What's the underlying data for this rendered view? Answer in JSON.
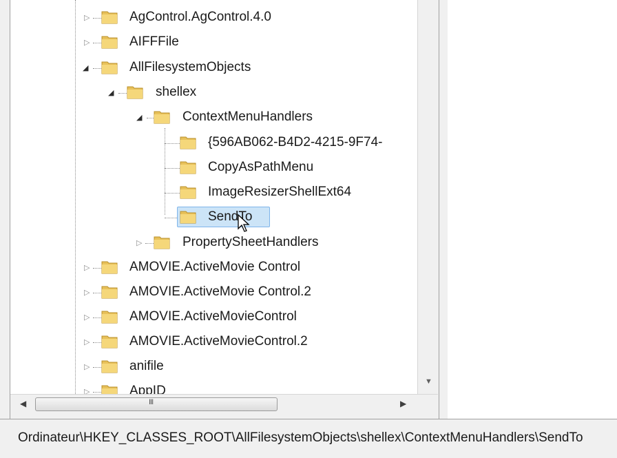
{
  "tree": {
    "items": [
      {
        "label": "AgControl.AgControl.4.0",
        "expander": "collapsed"
      },
      {
        "label": "AIFFFile",
        "expander": "collapsed"
      },
      {
        "label": "AllFilesystemObjects",
        "expander": "expanded"
      },
      {
        "label": "shellex",
        "expander": "expanded"
      },
      {
        "label": "ContextMenuHandlers",
        "expander": "expanded"
      },
      {
        "label": "{596AB062-B4D2-4215-9F74-",
        "expander": "none"
      },
      {
        "label": "CopyAsPathMenu",
        "expander": "none"
      },
      {
        "label": "ImageResizerShellExt64",
        "expander": "none"
      },
      {
        "label": "SendTo",
        "expander": "none",
        "selected": true
      },
      {
        "label": "PropertySheetHandlers",
        "expander": "collapsed"
      },
      {
        "label": "AMOVIE.ActiveMovie Control",
        "expander": "collapsed"
      },
      {
        "label": "AMOVIE.ActiveMovie Control.2",
        "expander": "collapsed"
      },
      {
        "label": "AMOVIE.ActiveMovieControl",
        "expander": "collapsed"
      },
      {
        "label": "AMOVIE.ActiveMovieControl.2",
        "expander": "collapsed"
      },
      {
        "label": "anifile",
        "expander": "collapsed"
      },
      {
        "label": "AppID",
        "expander": "collapsed"
      }
    ]
  },
  "hscroll": {
    "grip": "III"
  },
  "statusbar": {
    "path": "Ordinateur\\HKEY_CLASSES_ROOT\\AllFilesystemObjects\\shellex\\ContextMenuHandlers\\SendTo"
  },
  "icons": {
    "folder": "folder-icon",
    "expand": "triangle-right-icon",
    "collapse": "triangle-down-icon"
  },
  "colors": {
    "selection": "#cce4f7",
    "selection_border": "#7eb4ea",
    "folder": "#e8c15a"
  }
}
